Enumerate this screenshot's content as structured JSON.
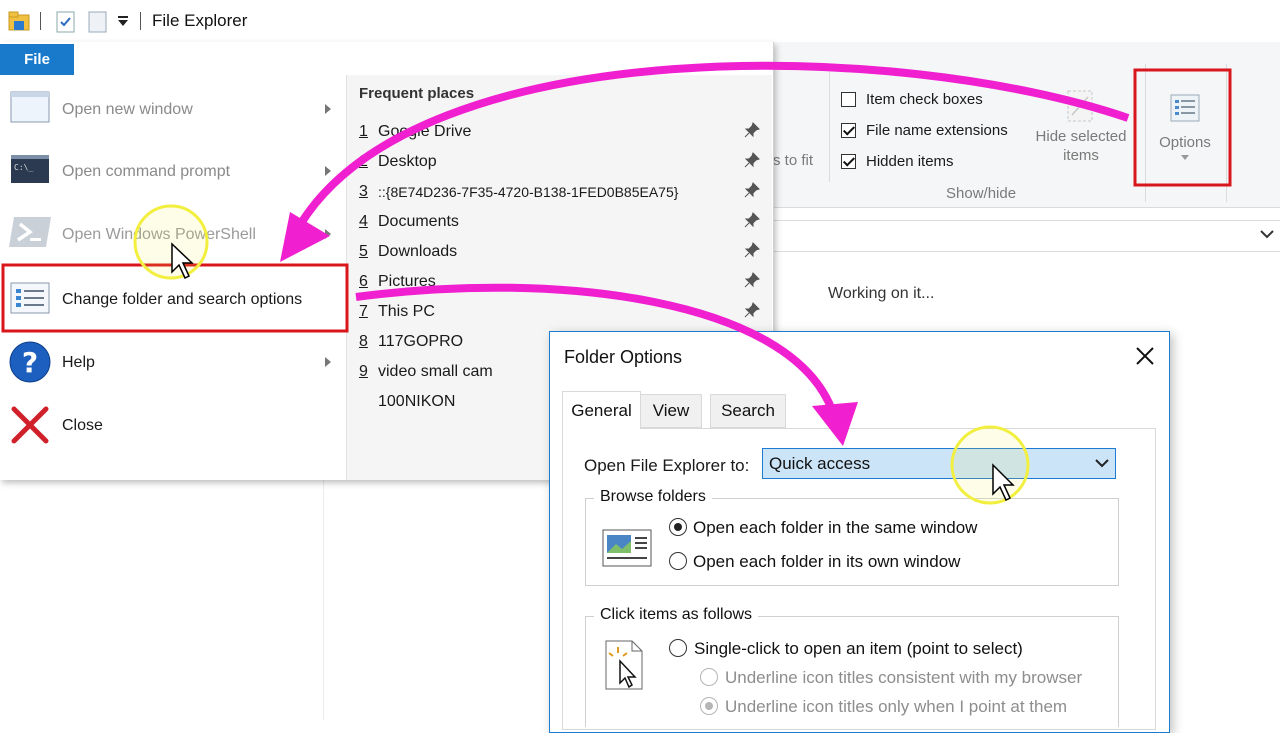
{
  "titlebar": {
    "title": "File Explorer",
    "icons": [
      "explorer-folder-icon",
      "properties-icon",
      "new-folder-icon",
      "customize-quick-access-icon"
    ]
  },
  "ribbon": {
    "partial_text": "s to fit",
    "checkboxes": [
      {
        "label": "Item check boxes",
        "checked": false
      },
      {
        "label": "File name extensions",
        "checked": true
      },
      {
        "label": "Hidden items",
        "checked": true
      }
    ],
    "hide_selected_label_1": "Hide selected",
    "hide_selected_label_2": "items",
    "options_label": "Options",
    "group_label": "Show/hide"
  },
  "main": {
    "status": "Working on it..."
  },
  "file_menu": {
    "tab_label": "File",
    "items": [
      {
        "label": "Open new window",
        "has_arrow": true,
        "disabled": true
      },
      {
        "label": "Open command prompt",
        "has_arrow": true,
        "disabled": true
      },
      {
        "label": "Open Windows PowerShell",
        "has_arrow": true,
        "disabled": true
      },
      {
        "label": "Change folder and search options",
        "has_arrow": false,
        "disabled": false
      },
      {
        "label": "Help",
        "has_arrow": true,
        "disabled": false
      },
      {
        "label": "Close",
        "has_arrow": false,
        "disabled": false
      }
    ],
    "frequent_title": "Frequent places",
    "frequent": [
      {
        "num": "1",
        "name": "Google Drive",
        "pinned": true
      },
      {
        "num": "2",
        "name": "Desktop",
        "pinned": true
      },
      {
        "num": "3",
        "name": "::{8E74D236-7F35-4720-B138-1FED0B85EA75}",
        "pinned": true
      },
      {
        "num": "4",
        "name": "Documents",
        "pinned": true
      },
      {
        "num": "5",
        "name": "Downloads",
        "pinned": true
      },
      {
        "num": "6",
        "name": "Pictures",
        "pinned": true
      },
      {
        "num": "7",
        "name": "This PC",
        "pinned": true
      },
      {
        "num": "8",
        "name": "117GOPRO",
        "pinned": false
      },
      {
        "num": "9",
        "name": "video small cam",
        "pinned": false
      },
      {
        "num": "",
        "name": "100NIKON",
        "pinned": false
      }
    ]
  },
  "dialog": {
    "title": "Folder Options",
    "tabs": [
      "General",
      "View",
      "Search"
    ],
    "open_to_label": "Open File Explorer to:",
    "open_to_value": "Quick access",
    "browse_legend": "Browse folders",
    "browse_options": [
      {
        "label": "Open each folder in the same window",
        "selected": true
      },
      {
        "label": "Open each folder in its own window",
        "selected": false
      }
    ],
    "click_legend": "Click items as follows",
    "click_options": [
      {
        "label": "Single-click to open an item (point to select)",
        "selected": false,
        "disabled": false
      },
      {
        "label": "Underline icon titles consistent with my browser",
        "selected": false,
        "disabled": true
      },
      {
        "label": "Underline icon titles only when I point at them",
        "selected": true,
        "disabled": true
      }
    ]
  },
  "colors": {
    "highlight_box": "#d9161c",
    "annotation_arrow": "#f020d0",
    "cursor_highlight": "#f2ef3e",
    "file_tab": "#1979ca",
    "combo_bg": "#cce4f7"
  }
}
